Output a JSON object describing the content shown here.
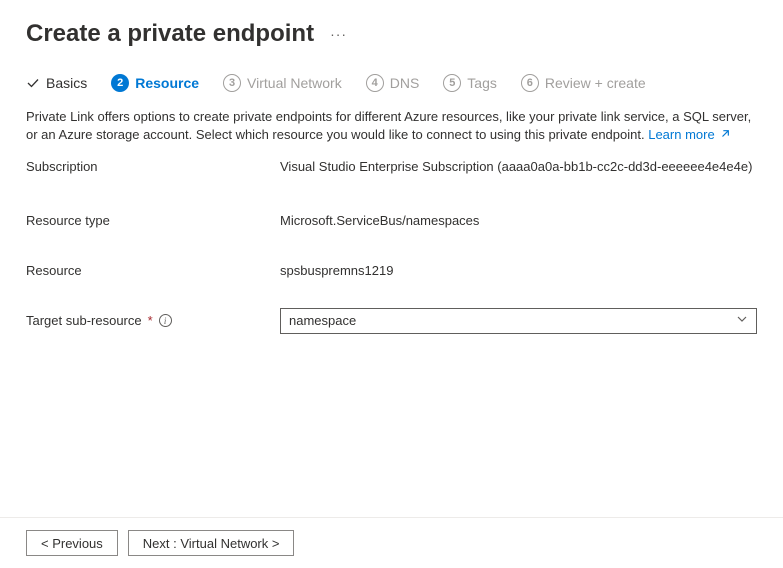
{
  "header": {
    "title": "Create a private endpoint"
  },
  "tabs": {
    "basics": "Basics",
    "resource": "Resource",
    "virtual_network": "Virtual Network",
    "dns": "DNS",
    "tags": "Tags",
    "review": "Review + create",
    "num3": "3",
    "num4": "4",
    "num5": "5",
    "num6": "6",
    "num2": "2"
  },
  "description": {
    "text": "Private Link offers options to create private endpoints for different Azure resources, like your private link service, a SQL server, or an Azure storage account. Select which resource you would like to connect to using this private endpoint.",
    "learn_more": "Learn more"
  },
  "form": {
    "subscription_label": "Subscription",
    "subscription_value": "Visual Studio Enterprise Subscription (aaaa0a0a-bb1b-cc2c-dd3d-eeeeee4e4e4e)",
    "resource_type_label": "Resource type",
    "resource_type_value": "Microsoft.ServiceBus/namespaces",
    "resource_label": "Resource",
    "resource_value": "spsbuspremns1219",
    "target_sub_label": "Target sub-resource",
    "target_sub_value": "namespace"
  },
  "footer": {
    "previous": "< Previous",
    "next": "Next : Virtual Network >"
  }
}
